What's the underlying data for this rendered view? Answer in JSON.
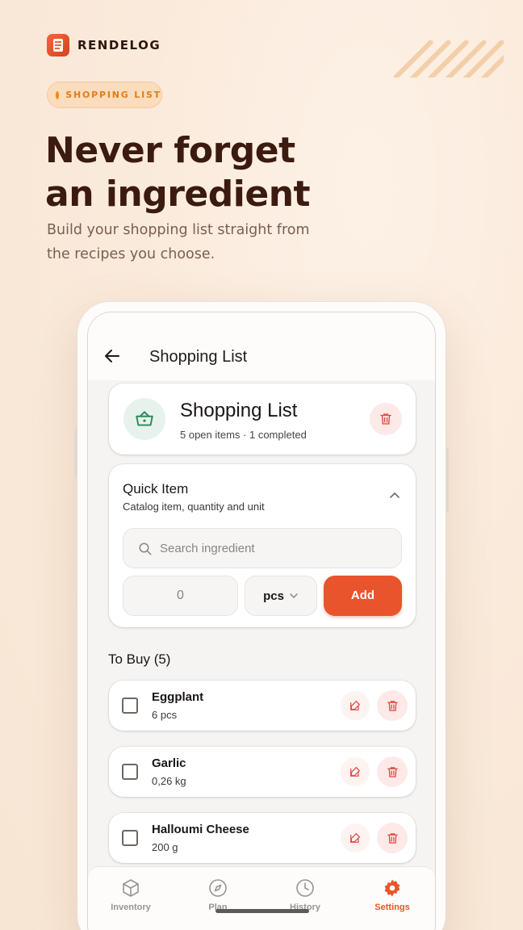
{
  "brand": {
    "name": "RENDELOG"
  },
  "badge": {
    "label": "SHOPPING LIST"
  },
  "hero": {
    "line1": "Never forget",
    "line2": "an ingredient",
    "subtitle": "Build your shopping list straight from the recipes you choose."
  },
  "appbar": {
    "title": "Shopping List"
  },
  "header_card": {
    "title": "Shopping List",
    "subtitle": "5 open items · 1 completed"
  },
  "quick_item": {
    "title": "Quick Item",
    "subtitle": "Catalog item, quantity and unit",
    "search_placeholder": "Search ingredient",
    "quantity": "0",
    "unit": "pcs",
    "add_label": "Add"
  },
  "to_buy": {
    "title": "To Buy (5)",
    "items": [
      {
        "name": "Eggplant",
        "qty": "6 pcs"
      },
      {
        "name": "Garlic",
        "qty": "0,26 kg"
      },
      {
        "name": "Halloumi Cheese",
        "qty": "200 g"
      }
    ]
  },
  "nav": {
    "items": [
      {
        "label": "Inventory",
        "icon": "cube-icon"
      },
      {
        "label": "Plan",
        "icon": "compass-icon"
      },
      {
        "label": "History",
        "icon": "clock-icon"
      },
      {
        "label": "Settings",
        "icon": "gear-icon"
      }
    ],
    "active": "Settings"
  },
  "colors": {
    "accent": "#e9542c",
    "badge": "#e27d1a",
    "basket": "#2e8a57",
    "danger": "#e0463f"
  }
}
